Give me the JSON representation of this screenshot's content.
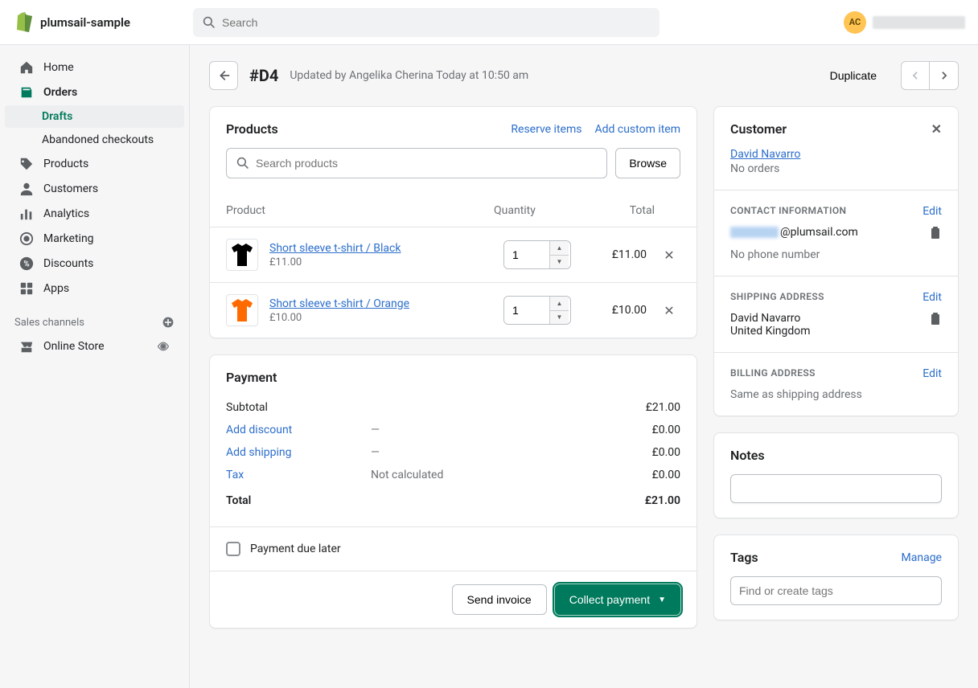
{
  "topbar": {
    "store_name": "plumsail-sample",
    "search_placeholder": "Search",
    "avatar_initials": "AC"
  },
  "sidebar": {
    "items": [
      {
        "label": "Home"
      },
      {
        "label": "Orders"
      },
      {
        "label": "Products"
      },
      {
        "label": "Customers"
      },
      {
        "label": "Analytics"
      },
      {
        "label": "Marketing"
      },
      {
        "label": "Discounts"
      },
      {
        "label": "Apps"
      }
    ],
    "orders_sub": [
      {
        "label": "Drafts"
      },
      {
        "label": "Abandoned checkouts"
      }
    ],
    "sales_channels_title": "Sales channels",
    "online_store": "Online Store"
  },
  "header": {
    "title": "#D4",
    "subtitle": "Updated by Angelika Cherina Today at 10:50 am",
    "duplicate": "Duplicate"
  },
  "products_card": {
    "title": "Products",
    "reserve": "Reserve items",
    "add_custom": "Add custom item",
    "search_placeholder": "Search products",
    "browse": "Browse",
    "col_product": "Product",
    "col_qty": "Quantity",
    "col_total": "Total",
    "rows": [
      {
        "title": "Short sleeve t-shirt / Black",
        "price": "£11.00",
        "qty": "1",
        "total": "£11.00",
        "color": "#000000"
      },
      {
        "title": "Short sleeve t-shirt / Orange",
        "price": "£10.00",
        "qty": "1",
        "total": "£10.00",
        "color": "#ff6a00"
      }
    ]
  },
  "payment_card": {
    "title": "Payment",
    "subtotal_label": "Subtotal",
    "subtotal_value": "£21.00",
    "discount_label": "Add discount",
    "discount_mid": "—",
    "discount_value": "£0.00",
    "shipping_label": "Add shipping",
    "shipping_mid": "—",
    "shipping_value": "£0.00",
    "tax_label": "Tax",
    "tax_mid": "Not calculated",
    "tax_value": "£0.00",
    "total_label": "Total",
    "total_value": "£21.00",
    "due_later": "Payment due later",
    "send_invoice": "Send invoice",
    "collect_payment": "Collect payment"
  },
  "customer_card": {
    "title": "Customer",
    "name": "David Navarro",
    "orders": "No orders",
    "contact_title": "CONTACT INFORMATION",
    "edit": "Edit",
    "email_suffix": "@plumsail.com",
    "no_phone": "No phone number",
    "shipping_title": "SHIPPING ADDRESS",
    "shipping_name": "David Navarro",
    "shipping_country": "United Kingdom",
    "billing_title": "BILLING ADDRESS",
    "billing_same": "Same as shipping address"
  },
  "notes_card": {
    "title": "Notes"
  },
  "tags_card": {
    "title": "Tags",
    "manage": "Manage",
    "placeholder": "Find or create tags"
  }
}
